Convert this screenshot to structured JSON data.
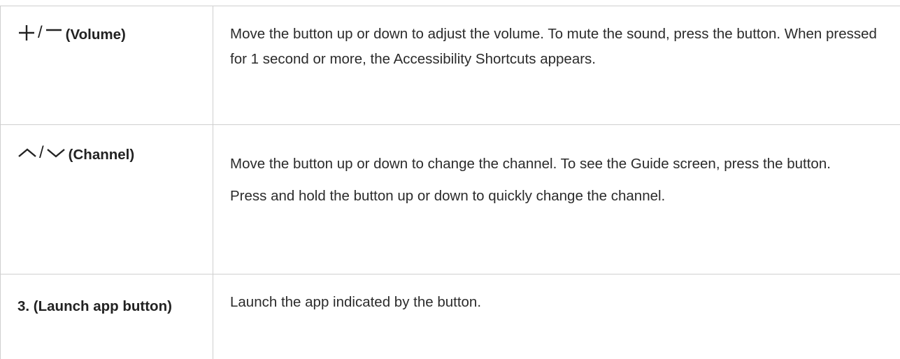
{
  "rows": [
    {
      "key_icons": [
        "plus-icon",
        "minus-icon"
      ],
      "key_label": "(Volume)",
      "description": [
        "Move the button up or down to adjust the volume. To mute the sound, press the button. When pressed for 1 second or more, the Accessibility Shortcuts appears."
      ]
    },
    {
      "key_icons": [
        "chevron-up-icon",
        "chevron-down-icon"
      ],
      "key_label": "(Channel)",
      "description": [
        "Move the button up or down to change the channel. To see the Guide screen, press the button.",
        "Press and hold the button up or down to quickly change the channel."
      ]
    },
    {
      "key_icons": [],
      "key_label": "3. (Launch app button)",
      "description": [
        "Launch the app indicated by the button."
      ]
    }
  ],
  "separator": "/"
}
